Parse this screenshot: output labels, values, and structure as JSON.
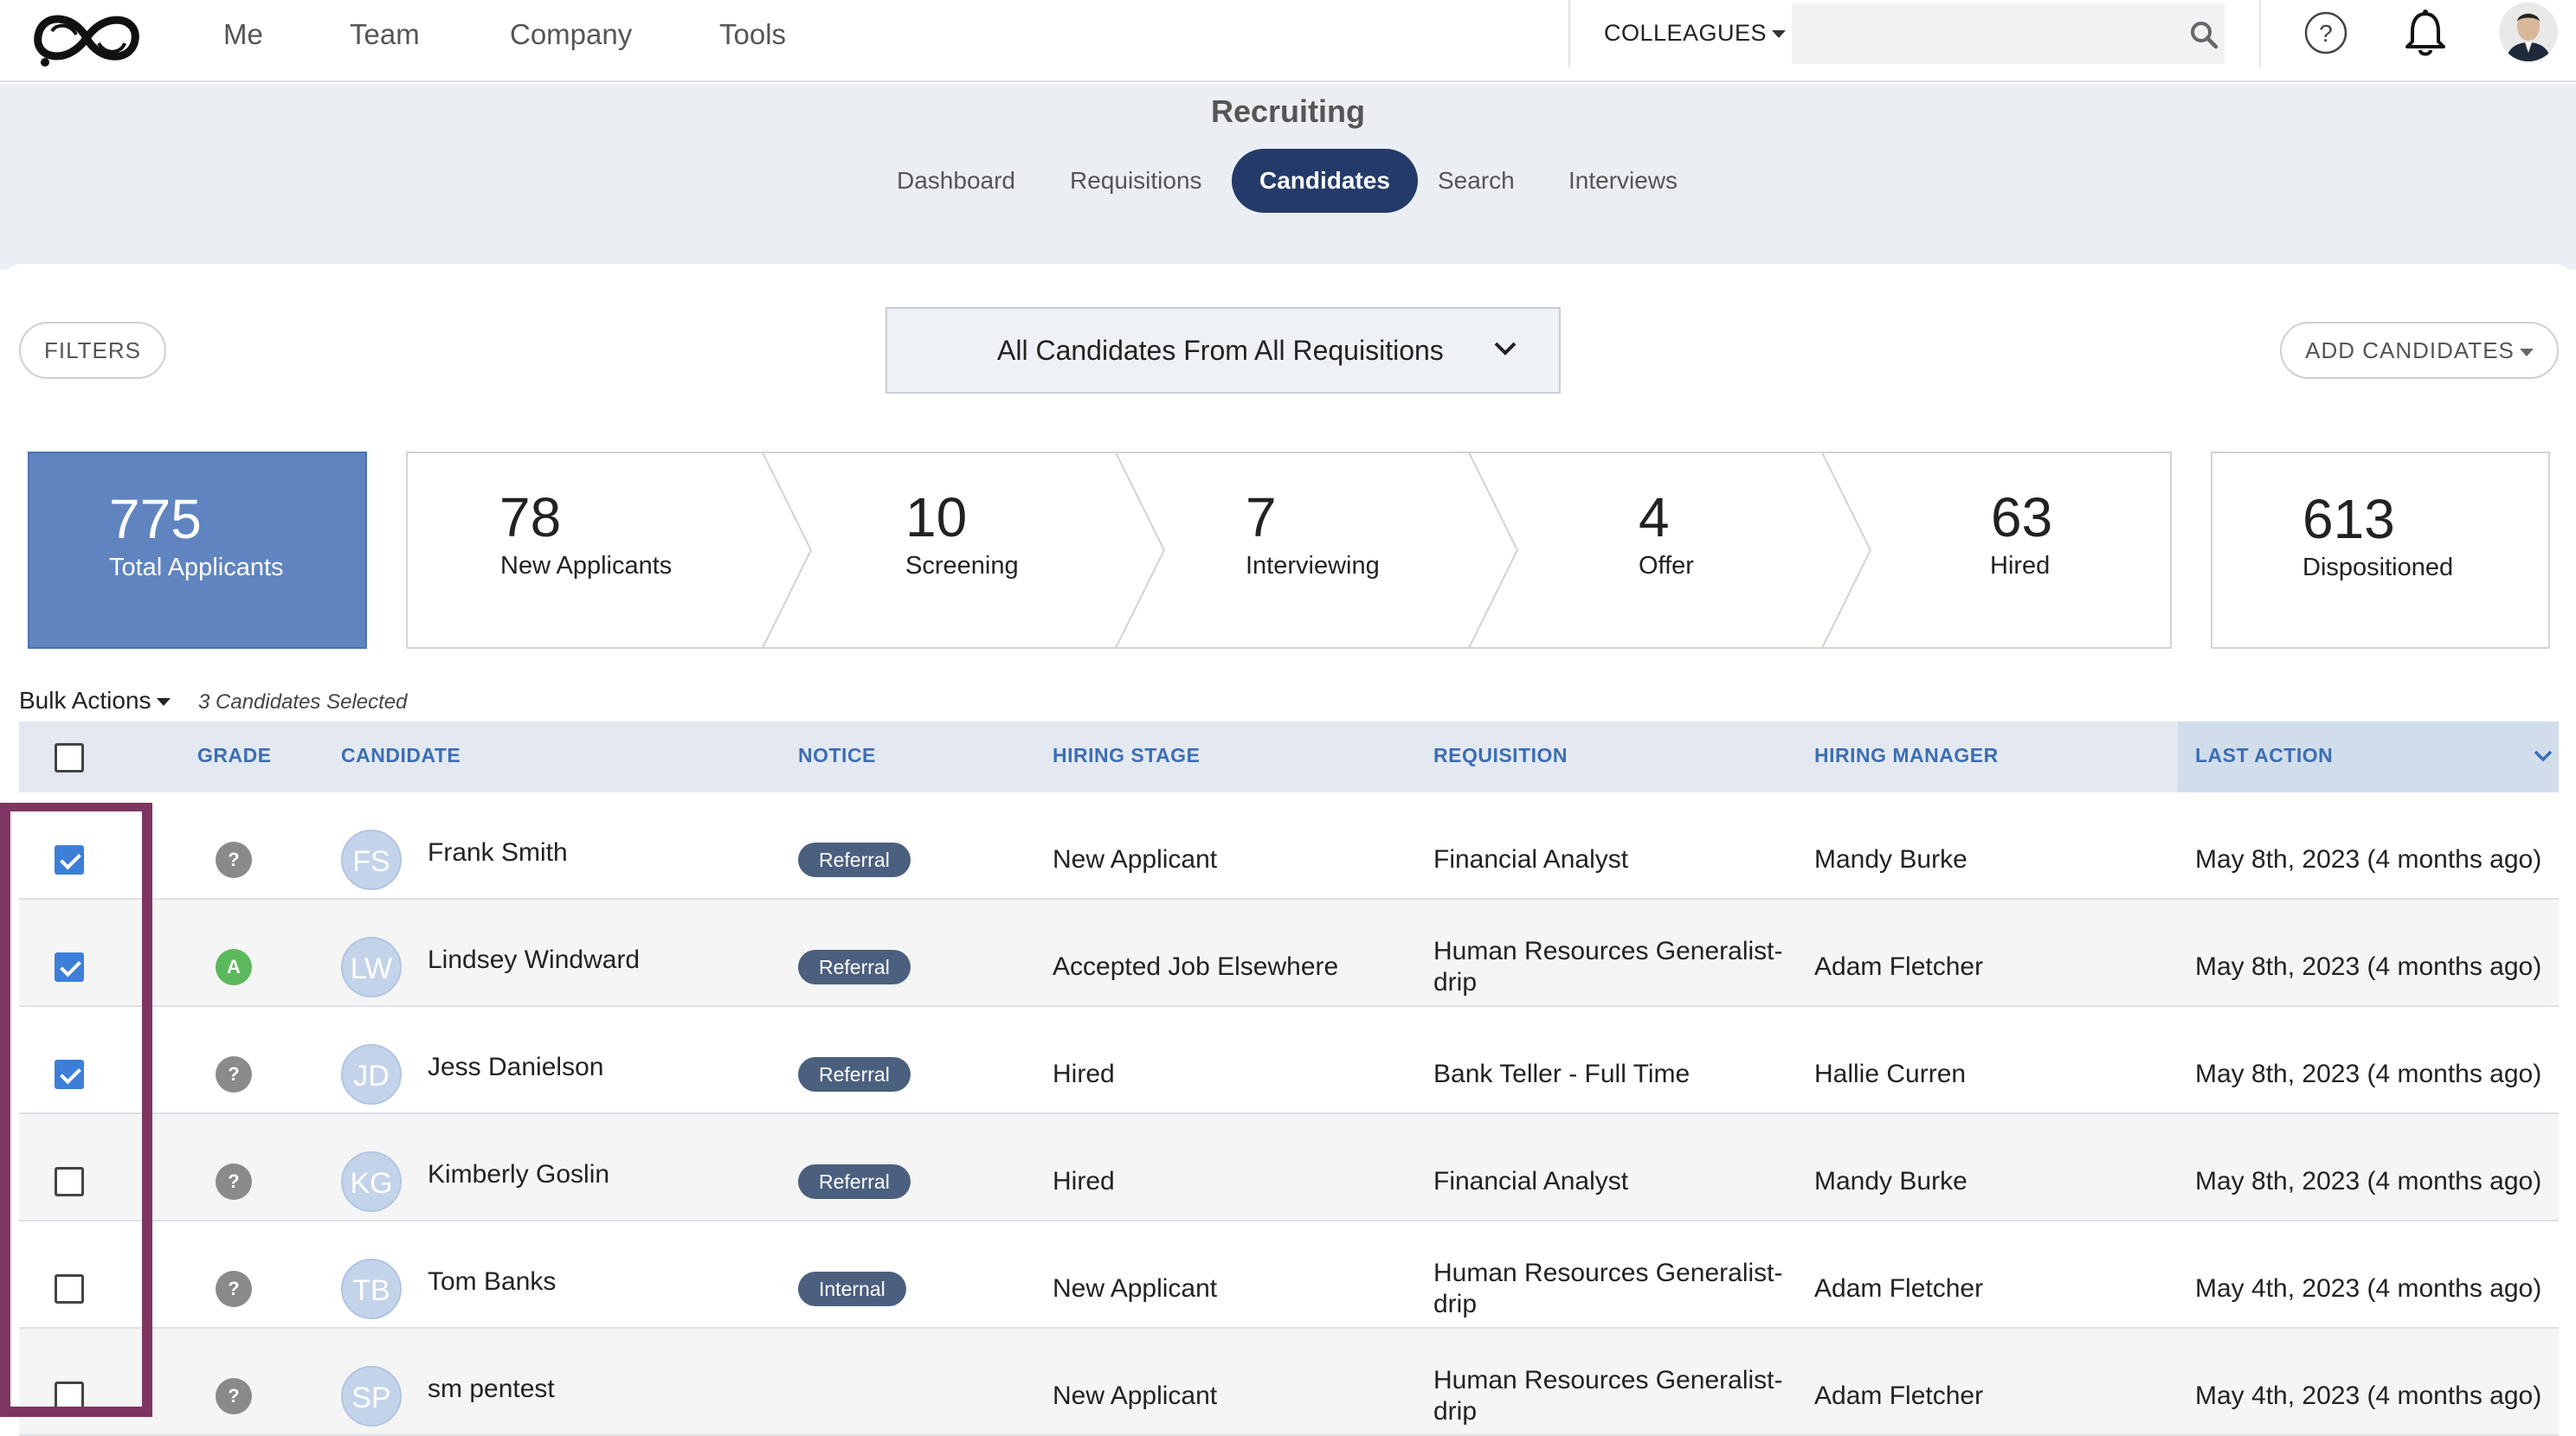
{
  "nav": {
    "items": [
      "Me",
      "Team",
      "Company",
      "Tools"
    ],
    "colleagues_label": "COLLEAGUES",
    "search_placeholder": "",
    "help_glyph": "?"
  },
  "header": {
    "title": "Recruiting",
    "tabs": [
      "Dashboard",
      "Requisitions",
      "Candidates",
      "Search",
      "Interviews"
    ],
    "active_tab": "Candidates"
  },
  "toolbar": {
    "filters_label": "FILTERS",
    "requisition_select": "All Candidates From All Requisitions",
    "add_candidates_label": "ADD CANDIDATES"
  },
  "stats": {
    "total": {
      "value": "775",
      "label": "Total Applicants"
    },
    "stages": [
      {
        "value": "78",
        "label": "New Applicants"
      },
      {
        "value": "10",
        "label": "Screening"
      },
      {
        "value": "7",
        "label": "Interviewing"
      },
      {
        "value": "4",
        "label": "Offer"
      },
      {
        "value": "63",
        "label": "Hired"
      }
    ],
    "dispositioned": {
      "value": "613",
      "label": "Dispositioned"
    }
  },
  "bulk": {
    "label": "Bulk Actions",
    "selected_text": "3 Candidates Selected"
  },
  "table": {
    "columns": [
      "GRADE",
      "CANDIDATE",
      "NOTICE",
      "HIRING STAGE",
      "REQUISITION",
      "HIRING MANAGER",
      "LAST ACTION"
    ],
    "rows": [
      {
        "checked": true,
        "grade": "?",
        "initials": "FS",
        "name": "Frank Smith",
        "notice": "Referral",
        "stage": "New Applicant",
        "requisition": "Financial Analyst",
        "requisition_line2": "",
        "manager": "Mandy Burke",
        "last_action": "May 8th, 2023 (4 months ago)"
      },
      {
        "checked": true,
        "grade": "A",
        "initials": "LW",
        "name": "Lindsey Windward",
        "notice": "Referral",
        "stage": "Accepted Job Elsewhere",
        "requisition": "Human Resources Generalist-",
        "requisition_line2": "drip",
        "manager": "Adam Fletcher",
        "last_action": "May 8th, 2023 (4 months ago)"
      },
      {
        "checked": true,
        "grade": "?",
        "initials": "JD",
        "name": "Jess Danielson",
        "notice": "Referral",
        "stage": "Hired",
        "requisition": "Bank Teller - Full Time",
        "requisition_line2": "",
        "manager": "Hallie Curren",
        "last_action": "May 8th, 2023 (4 months ago)"
      },
      {
        "checked": false,
        "grade": "?",
        "initials": "KG",
        "name": "Kimberly Goslin",
        "notice": "Referral",
        "stage": "Hired",
        "requisition": "Financial Analyst",
        "requisition_line2": "",
        "manager": "Mandy Burke",
        "last_action": "May 8th, 2023 (4 months ago)"
      },
      {
        "checked": false,
        "grade": "?",
        "initials": "TB",
        "name": "Tom Banks",
        "notice": "Internal",
        "stage": "New Applicant",
        "requisition": "Human Resources Generalist-",
        "requisition_line2": "drip",
        "manager": "Adam Fletcher",
        "last_action": "May 4th, 2023 (4 months ago)"
      },
      {
        "checked": false,
        "grade": "?",
        "initials": "SP",
        "name": "sm pentest",
        "notice": "",
        "stage": "New Applicant",
        "requisition": "Human Resources Generalist-",
        "requisition_line2": "drip",
        "manager": "Adam Fletcher",
        "last_action": "May 4th, 2023 (4 months ago)"
      }
    ]
  },
  "colors": {
    "accent": "#243b6a",
    "total_box": "#5f84c0",
    "header_text": "#3c6eb4",
    "highlight": "#7e3561",
    "checkbox_checked": "#3d7fd8",
    "grade_a": "#5cb85c"
  }
}
